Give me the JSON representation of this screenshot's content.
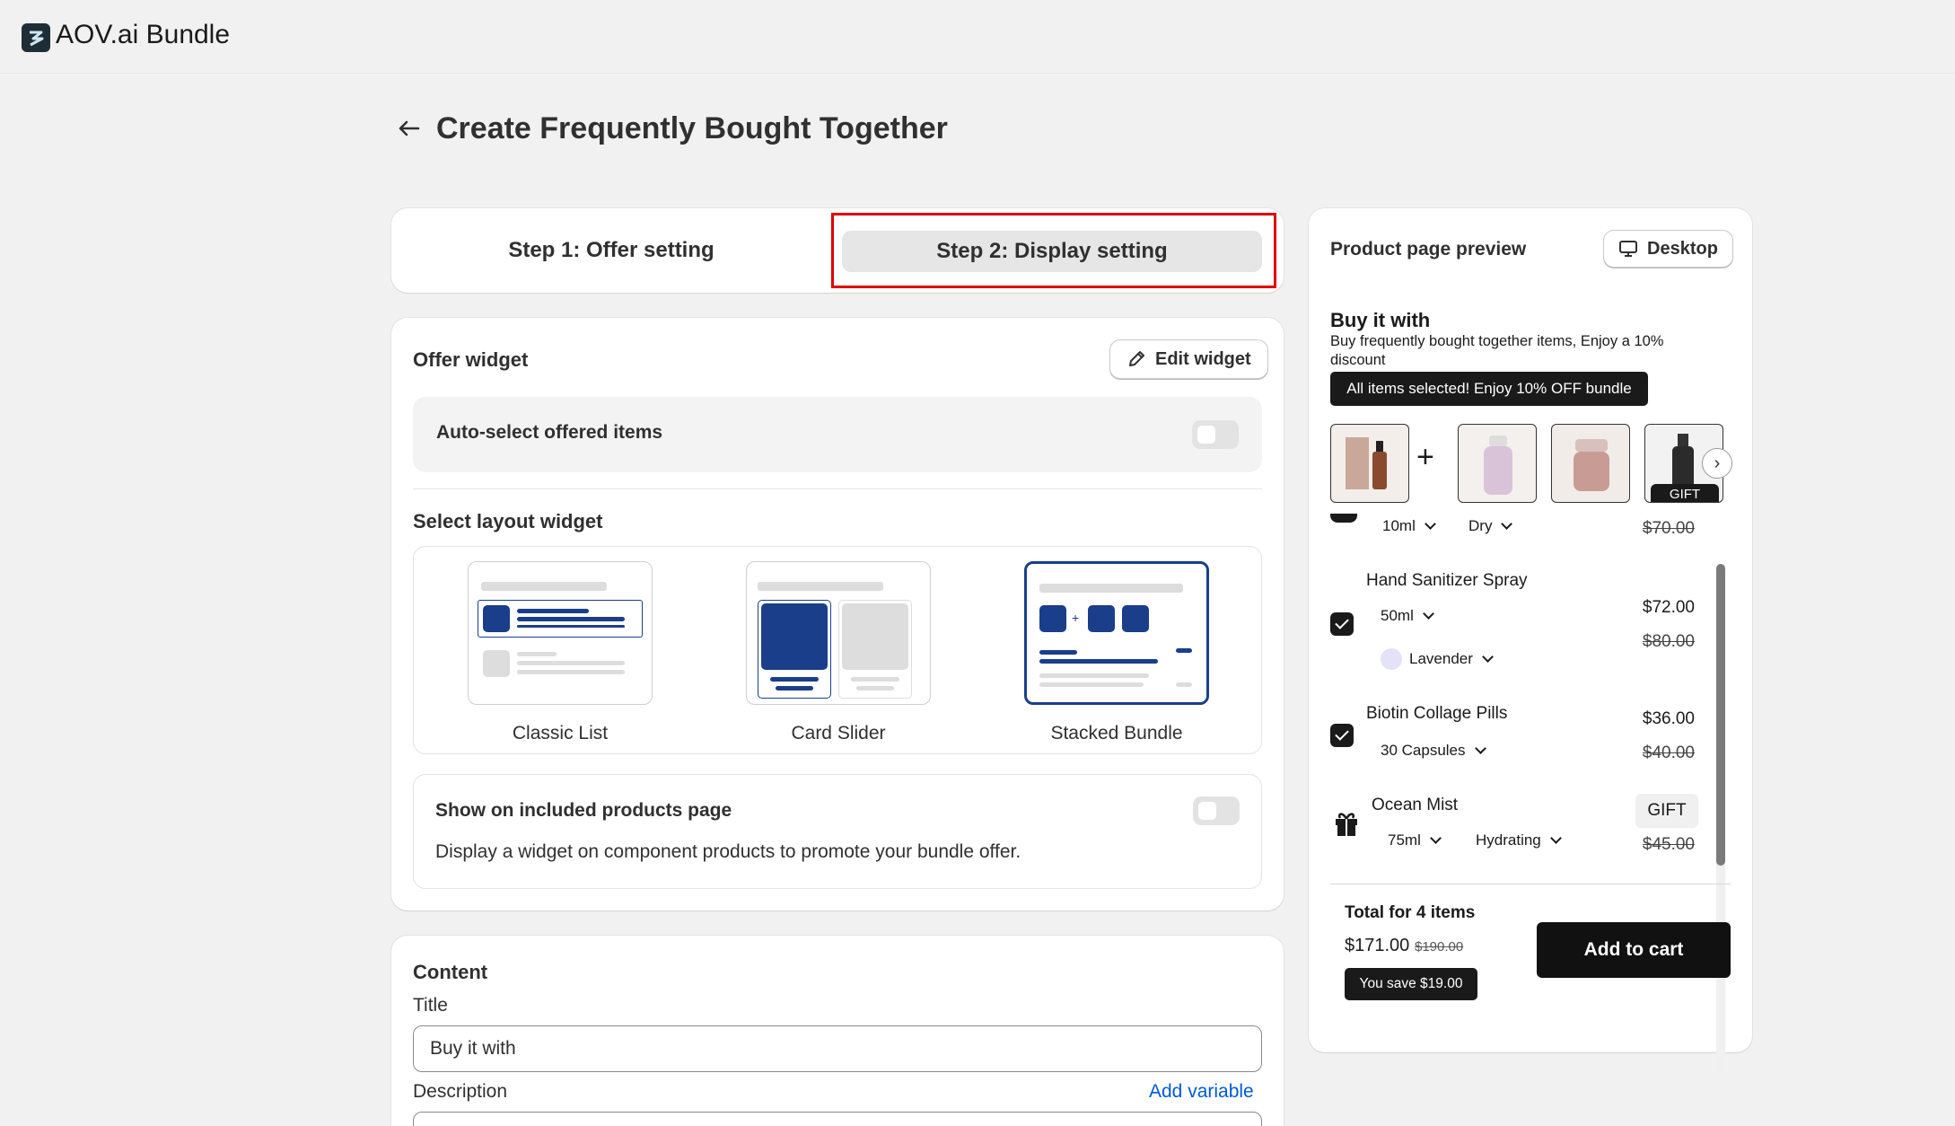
{
  "app": {
    "title": "AOV.ai Bundle",
    "logo_icon": "aov-logo-icon"
  },
  "header": {
    "back_icon": "arrow-left-icon",
    "title": "Create Frequently Bought Together"
  },
  "steps": [
    {
      "label": "Step 1: Offer setting",
      "active": false
    },
    {
      "label": "Step 2: Display setting",
      "active": true
    }
  ],
  "offer_widget": {
    "title": "Offer widget",
    "edit_button": "Edit widget",
    "auto_select": {
      "label": "Auto-select offered items",
      "enabled": false
    },
    "layout_title": "Select layout widget",
    "layouts": [
      {
        "label": "Classic List",
        "selected": false
      },
      {
        "label": "Card Slider",
        "selected": false
      },
      {
        "label": "Stacked Bundle",
        "selected": true
      }
    ],
    "show_included": {
      "title": "Show on included products page",
      "description": "Display a widget on component products to promote your bundle offer.",
      "enabled": false
    }
  },
  "content": {
    "section_title": "Content",
    "title_label": "Title",
    "title_value": "Buy it with",
    "description_label": "Description",
    "add_variable": "Add variable"
  },
  "preview": {
    "title": "Product page preview",
    "device_button": "Desktop",
    "widget": {
      "heading": "Buy it with",
      "description": "Buy frequently bought together items, Enjoy a 10% discount",
      "banner": "All items selected! Enjoy 10% OFF bundle",
      "gift_tag": "GIFT",
      "first_item": {
        "size": "10ml",
        "variant": "Dry",
        "old_price": "$70.00"
      },
      "items": [
        {
          "name": "Hand Sanitizer Spray",
          "size": "50ml",
          "variant": "Lavender",
          "price": "$72.00",
          "old_price": "$80.00",
          "checked": true
        },
        {
          "name": "Biotin Collage Pills",
          "size": "30 Capsules",
          "price": "$36.00",
          "old_price": "$40.00",
          "checked": true
        },
        {
          "name": "Ocean Mist",
          "size": "75ml",
          "variant": "Hydrating",
          "price": "GIFT",
          "old_price": "$45.00",
          "gift": true
        }
      ],
      "total_label": "Total for 4 items",
      "total_price": "$171.00",
      "total_old_price": "$190.00",
      "savings": "You save $19.00",
      "add_to_cart": "Add to cart"
    }
  },
  "colors": {
    "accent_red": "#e00000",
    "selected_blue": "#1a3e8a",
    "link_blue": "#005bd3"
  }
}
